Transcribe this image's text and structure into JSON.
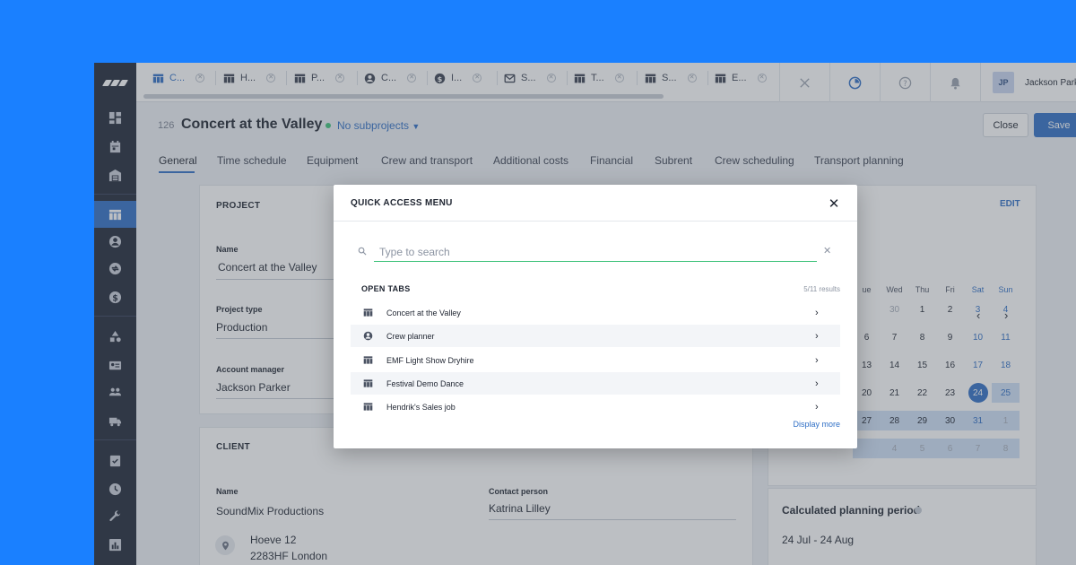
{
  "open_tabs_bar": [
    {
      "label": "C...",
      "icon": "table-icon",
      "active": true
    },
    {
      "label": "H...",
      "icon": "table-icon"
    },
    {
      "label": "P...",
      "icon": "table-icon"
    },
    {
      "label": "C...",
      "icon": "user-circle-icon"
    },
    {
      "label": "I...",
      "icon": "dollar-icon"
    },
    {
      "label": "S...",
      "icon": "mail-icon"
    },
    {
      "label": "T...",
      "icon": "table-icon"
    },
    {
      "label": "S...",
      "icon": "table-icon"
    },
    {
      "label": "E...",
      "icon": "table-icon"
    }
  ],
  "user": {
    "initials": "JP",
    "name": "Jackson Parker"
  },
  "project": {
    "id": "126",
    "title": "Concert at the Valley",
    "subprojects": "No subprojects",
    "close_label": "Close",
    "save_label": "Save"
  },
  "page_tabs": [
    "General",
    "Time schedule",
    "Equipment",
    "Crew and transport",
    "Additional costs",
    "Financial",
    "Subrent",
    "Crew scheduling",
    "Transport planning"
  ],
  "project_card": {
    "title": "PROJECT",
    "name_label": "Name",
    "name_value": "Concert at the Valley",
    "type_label": "Project type",
    "type_value": "Production",
    "manager_label": "Account manager",
    "manager_value": "Jackson Parker"
  },
  "client_card": {
    "title": "CLIENT",
    "name_label": "Name",
    "name_value": "SoundMix Productions",
    "contact_label": "Contact person",
    "contact_value": "Katrina Lilley",
    "address_line1": "Hoeve 12",
    "address_line2": "2283HF London"
  },
  "schedule_card": {
    "edit_label": "EDIT",
    "weekday_headers": [
      "ue",
      "Wed",
      "Thu",
      "Fri",
      "Sat",
      "Sun"
    ],
    "weeks": [
      [
        "",
        "30",
        "1",
        "2",
        "3",
        "4"
      ],
      [
        "6",
        "7",
        "8",
        "9",
        "10",
        "11"
      ],
      [
        "13",
        "14",
        "15",
        "16",
        "17",
        "18"
      ],
      [
        "20",
        "21",
        "22",
        "23",
        "24",
        "25"
      ],
      [
        "27",
        "28",
        "29",
        "30",
        "31",
        "1"
      ],
      [
        "",
        "4",
        "5",
        "6",
        "7",
        "8"
      ]
    ],
    "selected_day": "24",
    "planning_label": "Calculated planning period",
    "planning_value": "24 Jul - 24 Aug"
  },
  "modal": {
    "title": "QUICK ACCESS MENU",
    "search_placeholder": "Type to search",
    "open_tabs_heading": "OPEN TABS",
    "results_count": "5/11 results",
    "items": [
      {
        "label": "Concert at the Valley",
        "icon": "table-icon"
      },
      {
        "label": "Crew planner",
        "icon": "user-circle-icon"
      },
      {
        "label": "EMF Light Show Dryhire",
        "icon": "table-icon"
      },
      {
        "label": "Festival Demo Dance",
        "icon": "table-icon"
      },
      {
        "label": "Hendrik's Sales job",
        "icon": "table-icon"
      }
    ],
    "display_more": "Display more"
  },
  "colors": {
    "background": "#1a80ff",
    "sidebar": "#1e2636",
    "accent": "#2f6fc6",
    "status_green": "#3ec27a"
  }
}
